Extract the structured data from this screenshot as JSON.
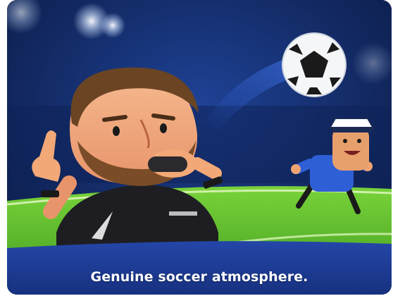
{
  "caption": "Genuine soccer atmosphere.",
  "colors": {
    "sky_dark": "#0b1a45",
    "sky_mid": "#1b3a86",
    "pitch": "#5fbf2e",
    "referee_shirt": "#1e1e22",
    "player_shirt": "#2f5fd6",
    "caption_band": "#1c3b97"
  }
}
